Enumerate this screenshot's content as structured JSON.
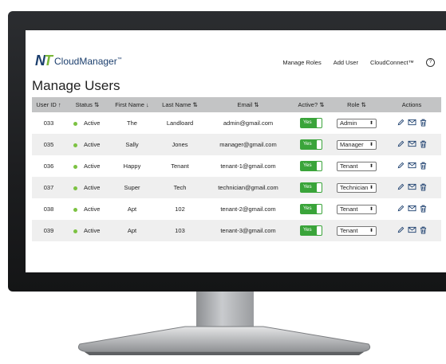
{
  "brand": {
    "mark_n": "N",
    "mark_t": "T",
    "name": "CloudManager",
    "tm": "™"
  },
  "nav": {
    "manage_roles": "Manage Roles",
    "add_user": "Add User",
    "cloudconnect": "CloudConnect™",
    "help": "?"
  },
  "page_title": "Manage Users",
  "table": {
    "headers": [
      "User ID ↑",
      "Status ⇅",
      "First Name ↓",
      "Last Name ⇅",
      "Email ⇅",
      "Active? ⇅",
      "Role ⇅",
      "Actions"
    ],
    "toggle_label": "Yes",
    "rows": [
      {
        "id": "033",
        "status": "Active",
        "first": "The",
        "last": "Landloard",
        "email": "admin@gmail.com",
        "role": "Admin"
      },
      {
        "id": "035",
        "status": "Active",
        "first": "Sally",
        "last": "Jones",
        "email": "manager@gmail.com",
        "role": "Manager"
      },
      {
        "id": "036",
        "status": "Active",
        "first": "Happy",
        "last": "Tenant",
        "email": "tenant-1@gmail.com",
        "role": "Tenant"
      },
      {
        "id": "037",
        "status": "Active",
        "first": "Super",
        "last": "Tech",
        "email": "technician@gmail.com",
        "role": "Technician"
      },
      {
        "id": "038",
        "status": "Active",
        "first": "Apt",
        "last": "102",
        "email": "tenant-2@gmail.com",
        "role": "Tenant"
      },
      {
        "id": "039",
        "status": "Active",
        "first": "Apt",
        "last": "103",
        "email": "tenant-3@gmail.com",
        "role": "Tenant"
      }
    ]
  },
  "colors": {
    "active_dot": "#7cc242",
    "toggle": "#3aa43a",
    "header_bg": "#c3c4c5",
    "brand_dark": "#1c3f6e",
    "brand_green": "#7ab83a"
  },
  "icons": {
    "edit": "pencil-icon",
    "email": "envelope-icon",
    "delete": "trash-icon",
    "role": "select-arrows-icon",
    "help": "help-icon"
  }
}
